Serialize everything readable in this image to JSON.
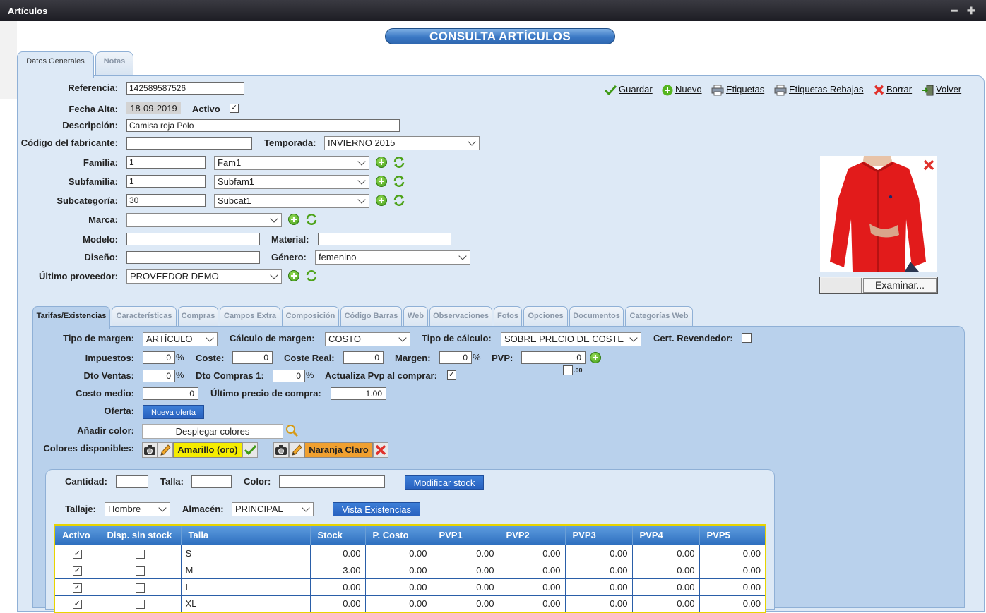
{
  "window": {
    "title": "Artículos",
    "minimize": "━",
    "maximize": "✚"
  },
  "banner": "CONSULTA ARTÍCULOS",
  "tabs": [
    {
      "label": "Datos Generales"
    },
    {
      "label": "Notas"
    }
  ],
  "actions": {
    "save": "Guardar",
    "new": "Nuevo",
    "labels": "Etiquetas",
    "sale_labels": "Etiquetas Rebajas",
    "delete": "Borrar",
    "back": "Volver"
  },
  "form": {
    "referencia": {
      "label": "Referencia:",
      "value": "142589587526"
    },
    "fecha_alta": {
      "label": "Fecha Alta:",
      "value": "18-09-2019"
    },
    "activo": {
      "label": "Activo",
      "checked": "✓"
    },
    "descripcion": {
      "label": "Descripción:",
      "value": "Camisa roja Polo"
    },
    "codigo_fabricante": {
      "label": "Código del fabricante:",
      "value": ""
    },
    "temporada": {
      "label": "Temporada:",
      "value": "INVIERNO 2015"
    },
    "familia": {
      "label": "Familia:",
      "code": "1",
      "value": "Fam1"
    },
    "subfamilia": {
      "label": "Subfamilia:",
      "code": "1",
      "value": "Subfam1"
    },
    "subcategoria": {
      "label": "Subcategoría:",
      "code": "30",
      "value": "Subcat1"
    },
    "marca": {
      "label": "Marca:",
      "value": ""
    },
    "modelo": {
      "label": "Modelo:",
      "value": ""
    },
    "material": {
      "label": "Material:",
      "value": ""
    },
    "diseno": {
      "label": "Diseño:",
      "value": ""
    },
    "genero": {
      "label": "Género:",
      "value": "femenino"
    },
    "ultimo_proveedor": {
      "label": "Último proveedor:",
      "value": "PROVEEDOR DEMO"
    }
  },
  "image": {
    "browse_button": "Examinar..."
  },
  "subtabs": [
    "Tarifas/Existencias",
    "Características",
    "Compras",
    "Campos Extra",
    "Composición",
    "Código Barras",
    "Web",
    "Observaciones",
    "Fotos",
    "Opciones",
    "Documentos",
    "Categorías Web"
  ],
  "tarifas": {
    "tipo_margen": {
      "label": "Tipo de margen:",
      "value": "ARTÍCULO"
    },
    "calculo_margen": {
      "label": "Cálculo de margen:",
      "value": "COSTO"
    },
    "tipo_calculo": {
      "label": "Tipo de cálculo:",
      "value": "SOBRE PRECIO DE COSTE"
    },
    "cert_revendedor": {
      "label": "Cert. Revendedor:"
    },
    "impuestos": {
      "label": "Impuestos:",
      "value": "0"
    },
    "coste": {
      "label": "Coste:",
      "value": "0"
    },
    "coste_real": {
      "label": "Coste Real:",
      "value": "0"
    },
    "margen": {
      "label": "Margen:",
      "value": "0"
    },
    "pvp": {
      "label": "PVP:",
      "value": "0",
      "decimals": ".00"
    },
    "dto_ventas": {
      "label": "Dto Ventas:",
      "value": "0"
    },
    "dto_compras": {
      "label": "Dto Compras 1:",
      "value": "0"
    },
    "actualiza_pvp": {
      "label": "Actualiza Pvp al comprar:",
      "checked": "✓"
    },
    "costo_medio": {
      "label": "Costo medio:",
      "value": "0"
    },
    "ultimo_precio": {
      "label": "Último precio de compra:",
      "value": "1.00"
    },
    "oferta": {
      "label": "Oferta:",
      "button": "Nueva oferta"
    },
    "anadir_color": {
      "label": "Añadir color:",
      "button": "Desplegar colores"
    },
    "colores": {
      "label": "Colores disponibles:",
      "items": [
        {
          "name": "Amarillo (oro)",
          "color": "#f5ec00"
        },
        {
          "name": "Naranja Claro",
          "color": "#f0a030"
        }
      ]
    },
    "percent": "%"
  },
  "stock": {
    "cantidad": {
      "label": "Cantidad:",
      "value": ""
    },
    "talla": {
      "label": "Talla:",
      "value": ""
    },
    "color": {
      "label": "Color:",
      "value": ""
    },
    "modificar": "Modificar stock",
    "tallaje": {
      "label": "Tallaje:",
      "value": "Hombre"
    },
    "almacen": {
      "label": "Almacén:",
      "value": "PRINCIPAL"
    },
    "vista": "Vista Existencias",
    "columns": [
      "Activo",
      "Disp. sin stock",
      "Talla",
      "Stock",
      "P. Costo",
      "PVP1",
      "PVP2",
      "PVP3",
      "PVP4",
      "PVP5"
    ],
    "rows": [
      {
        "activo": "✓",
        "disp": "",
        "talla": "S",
        "stock": "0.00",
        "costo": "0.00",
        "pvp1": "0.00",
        "pvp2": "0.00",
        "pvp3": "0.00",
        "pvp4": "0.00",
        "pvp5": "0.00"
      },
      {
        "activo": "✓",
        "disp": "",
        "talla": "M",
        "stock": "-3.00",
        "costo": "0.00",
        "pvp1": "0.00",
        "pvp2": "0.00",
        "pvp3": "0.00",
        "pvp4": "0.00",
        "pvp5": "0.00"
      },
      {
        "activo": "✓",
        "disp": "",
        "talla": "L",
        "stock": "0.00",
        "costo": "0.00",
        "pvp1": "0.00",
        "pvp2": "0.00",
        "pvp3": "0.00",
        "pvp4": "0.00",
        "pvp5": "0.00"
      },
      {
        "activo": "✓",
        "disp": "",
        "talla": "XL",
        "stock": "0.00",
        "costo": "0.00",
        "pvp1": "0.00",
        "pvp2": "0.00",
        "pvp3": "0.00",
        "pvp4": "0.00",
        "pvp5": "0.00"
      }
    ]
  },
  "colors": {
    "accent_blue": "#2e6fbf",
    "panel_bg": "#dde9f6",
    "grid_border": "#e8d400"
  }
}
